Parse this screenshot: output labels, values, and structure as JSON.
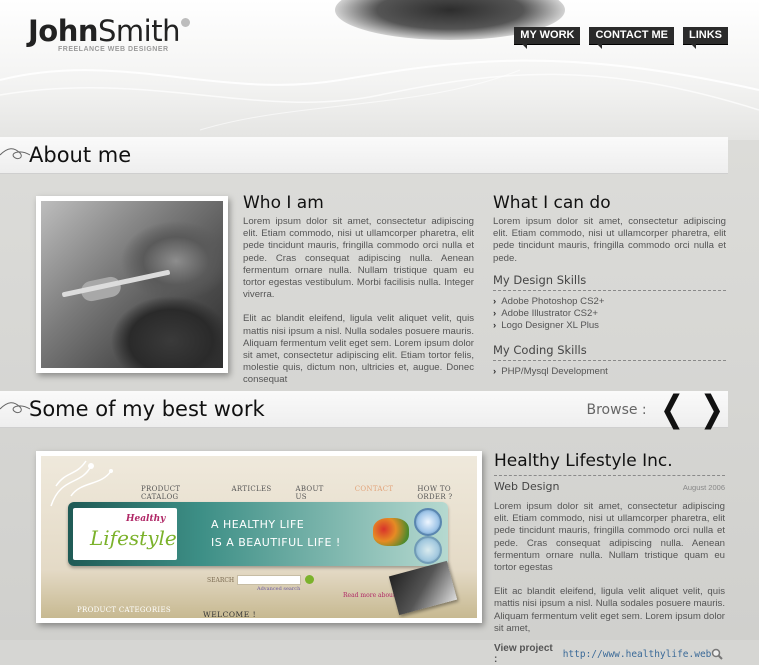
{
  "logo": {
    "first": "John",
    "last": "Smith",
    "tagline": "FREELANCE WEB DESIGNER"
  },
  "nav": [
    {
      "label": "MY WORK"
    },
    {
      "label": "CONTACT ME"
    },
    {
      "label": "LINKS"
    }
  ],
  "about": {
    "title": "About me",
    "who": {
      "heading": "Who I am",
      "p1": "Lorem ipsum dolor sit amet, consectetur adipiscing elit. Etiam commodo, nisi ut ullamcorper pharetra, elit pede tincidunt mauris, fringilla commodo orci nulla et pede. Cras consequat adipiscing nulla. Aenean fermentum ornare nulla. Nullam tristique quam eu tortor egestas vestibulum. Morbi facilisis nulla. Integer viverra.",
      "p2": "Elit ac blandit eleifend, ligula velit aliquet velit, quis mattis nisi ipsum a nisl. Nulla sodales posuere mauris. Aliquam fermentum velit eget sem. Lorem ipsum dolor sit amet, consectetur adipiscing elit. Etiam tortor felis, molestie quis, dictum non, ultricies et, augue. Donec consequat"
    },
    "can": {
      "heading": "What I can do",
      "p1": "Lorem ipsum dolor sit amet, consectetur adipiscing elit. Etiam commodo, nisi ut ullamcorper pharetra, elit pede tincidunt mauris, fringilla commodo orci nulla et pede.",
      "design_heading": "My Design Skills",
      "design_skills": [
        "Adobe Photoshop CS2+",
        "Adobe Illustrator CS2+",
        "Logo Designer XL Plus"
      ],
      "coding_heading": "My Coding Skills",
      "coding_skills": [
        "PHP/Mysql Development"
      ]
    }
  },
  "work": {
    "title": "Some of my best work",
    "browse_label": "Browse :",
    "prev_symbol": "❮",
    "next_symbol": "❯",
    "project": {
      "name": "Healthy Lifestyle Inc.",
      "type": "Web Design",
      "date": "August 2006",
      "p1": "Lorem ipsum dolor sit amet, consectetur adipiscing elit. Etiam commodo, nisi ut ullamcorper pharetra, elit pede tincidunt mauris, fringilla commodo orci nulla et pede. Cras consequat adipiscing nulla. Aenean fermentum ornare nulla. Nullam tristique quam eu tortor egestas",
      "p2": "Elit ac blandit eleifend, ligula velit aliquet velit, quis mattis nisi ipsum a nisl. Nulla sodales posuere mauris. Aliquam fermentum velit eget sem. Lorem ipsum dolor sit amet,",
      "view_label": "View project :",
      "view_url": "http://www.healthylife.web"
    },
    "screenshot": {
      "nav": [
        "PRODUCT CATALOG",
        "ARTICLES",
        "ABOUT US",
        "CONTACT",
        "HOW TO ORDER ?"
      ],
      "logo_small": "Healthy",
      "logo_big": "Lifestyle",
      "slogan1": "A HEALTHY LIFE",
      "slogan2": "IS A BEAUTIFUL LIFE !",
      "search_label": "SEARCH",
      "advanced": "Advanced search",
      "read_more": "Read more about",
      "categories": "PRODUCT CATEGORIES",
      "welcome": "WELCOME !"
    }
  },
  "colors": {
    "bar": "#f4f4f4",
    "nav_bg": "#2b2b2b",
    "link": "#3b6a98",
    "body_bg": "#d6d6d3"
  }
}
